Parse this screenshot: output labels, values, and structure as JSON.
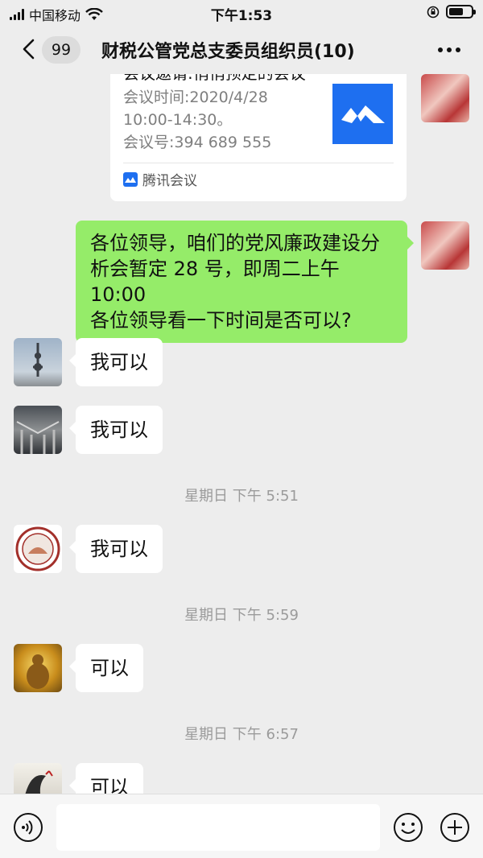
{
  "status_bar": {
    "carrier": "中国移动",
    "time": "下午1:53",
    "battery_level": 0.65
  },
  "nav": {
    "unread_count": "99",
    "title": "财税公管党总支委员组织员(10)"
  },
  "meeting_card": {
    "title": "会议邀请:悄悄预定的会议",
    "time_label": "会议时间:2020/4/28",
    "time_range": "10:00-14:30。",
    "meeting_id": "会议号:394 689 555",
    "source": "腾讯会议",
    "brand_color": "#1e6ff0"
  },
  "messages": [
    {
      "side": "out",
      "lines": [
        "各位领导，咱们的党风廉政建设分",
        "析会暂定 28 号，即周二上午 10:00",
        "各位领导看一下时间是否可以?"
      ]
    },
    {
      "side": "in",
      "text": "我可以"
    },
    {
      "side": "in",
      "text": "我可以"
    },
    {
      "timestamp": "星期日 下午 5:51"
    },
    {
      "side": "in",
      "text": "我可以"
    },
    {
      "timestamp": "星期日 下午 5:59"
    },
    {
      "side": "in",
      "text": "可以"
    },
    {
      "timestamp": "星期日 下午 6:57"
    },
    {
      "side": "in",
      "text": "可以"
    }
  ],
  "colors": {
    "background": "#ededed",
    "outgoing_bubble": "#95ec69",
    "incoming_bubble": "#ffffff",
    "timestamp_text": "#9b9b9b"
  }
}
